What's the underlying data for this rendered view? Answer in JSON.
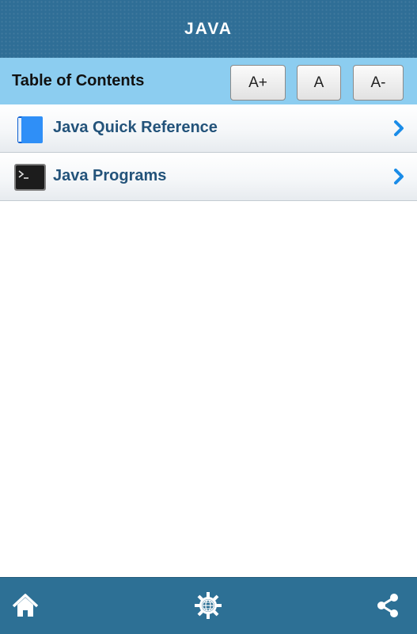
{
  "header": {
    "title": "JAVA"
  },
  "toc": {
    "title": "Table of Contents",
    "increase_label": "A+",
    "normal_label": "A",
    "decrease_label": "A-"
  },
  "items": [
    {
      "label": "Java Quick Reference",
      "icon": "book-icon"
    },
    {
      "label": "Java Programs",
      "icon": "terminal-icon"
    }
  ],
  "footer": {
    "icons": [
      "home-icon",
      "settings-globe-icon",
      "share-icon"
    ]
  },
  "colors": {
    "header_bg": "#2f6e96",
    "toc_bar_bg": "#8ccdf0",
    "item_text": "#23537a",
    "chevron": "#1a8ce8",
    "footer_bg": "#2d7095"
  }
}
